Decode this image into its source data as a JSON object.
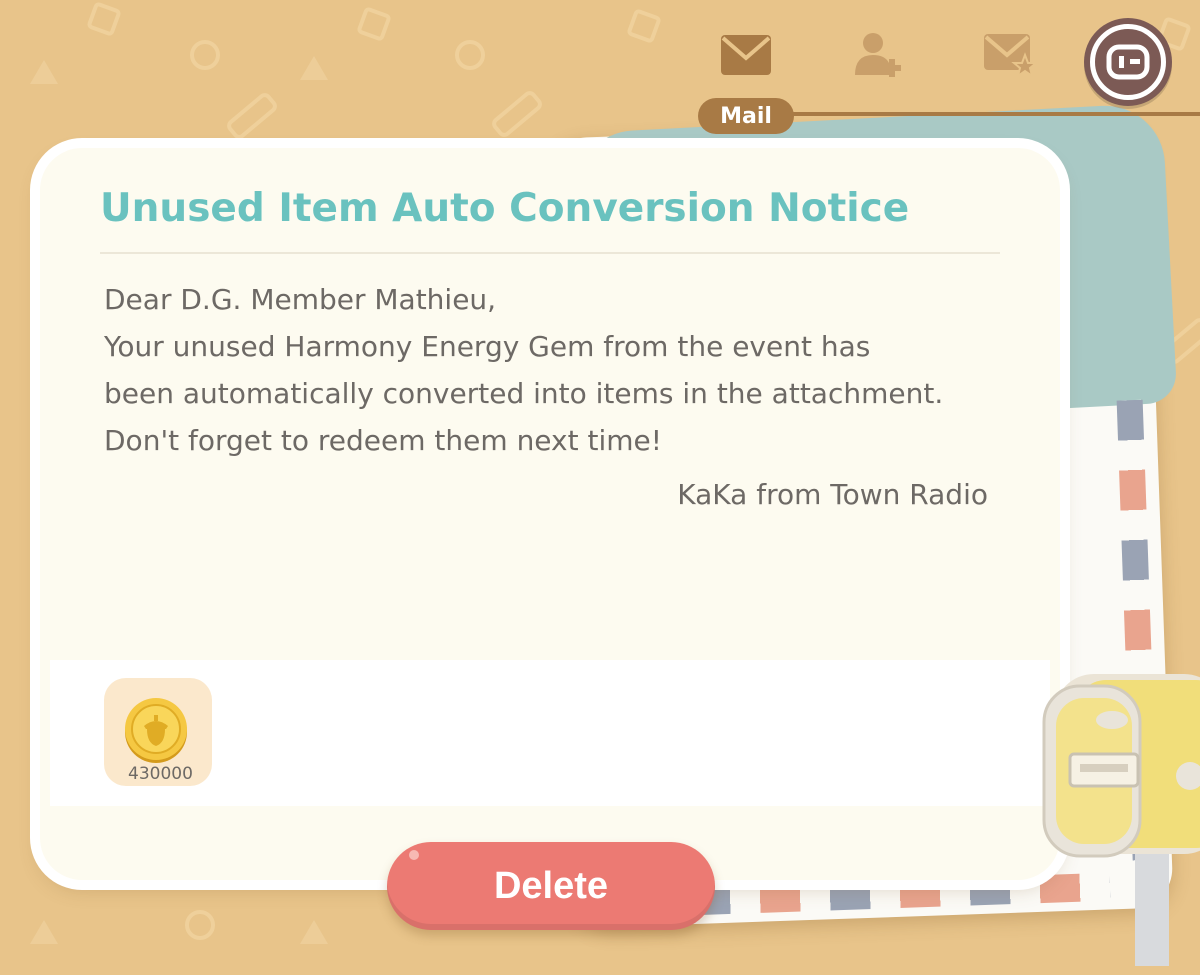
{
  "nav": {
    "active_tab_label": "Mail",
    "tabs": [
      {
        "icon": "mail-icon"
      },
      {
        "icon": "add-friend-icon"
      },
      {
        "icon": "starred-mail-icon"
      }
    ],
    "exit_icon": "exit-door-icon"
  },
  "mail": {
    "title": "Unused Item Auto Conversion Notice",
    "body_lines": [
      "Dear D.G. Member Mathieu,",
      "Your unused Harmony Energy Gem from the event has",
      "been automatically converted into items in the attachment.",
      "Don't forget to redeem them next time!"
    ],
    "signature": "KaKa from Town Radio",
    "attachments": [
      {
        "icon": "acorn-coin-icon",
        "quantity": "430000"
      }
    ]
  },
  "actions": {
    "delete_label": "Delete"
  },
  "colors": {
    "background": "#e8c48a",
    "title": "#6ac2bf",
    "delete_button": "#ec7a73",
    "nav_active": "#a87a45"
  }
}
